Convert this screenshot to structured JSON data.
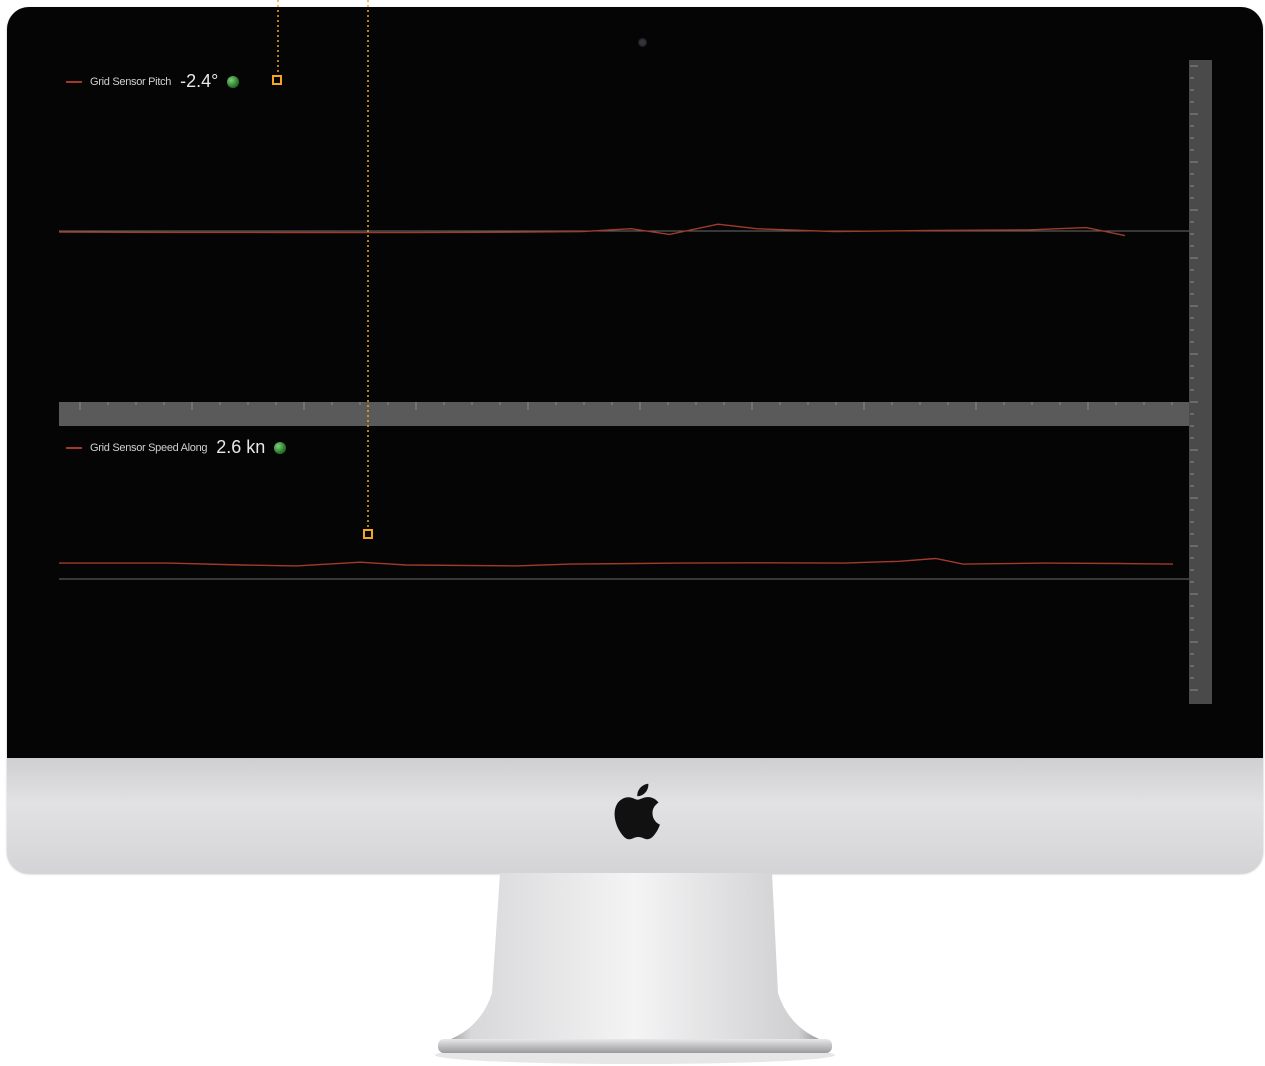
{
  "pitch_panel": {
    "series_name": "Grid Sensor Pitch",
    "current_value": "-2.4°",
    "status_color": "#3e9a3a",
    "series_color": "#a23a2a"
  },
  "speed_panel": {
    "series_name": "Grid Sensor Speed Along",
    "current_value": "2.6 kn",
    "status_color": "#3e9a3a",
    "series_color": "#a23a2a"
  },
  "colors": {
    "background": "#050505",
    "axis_bar": "#5a5a5a",
    "annotation_marker": "#f5a623"
  },
  "icons": {
    "device_logo": "apple-logo-icon",
    "status_indicator": "green-led-icon",
    "annotation": "highlight-marker-icon"
  },
  "chart_data": [
    {
      "type": "line",
      "series": [
        {
          "name": "Grid Sensor Pitch",
          "x": [
            0,
            120,
            240,
            360,
            480,
            540,
            590,
            630,
            680,
            720,
            800,
            900,
            1000,
            1060,
            1100
          ],
          "y": [
            -1,
            -1.2,
            -1.3,
            -1.4,
            -1,
            -0.5,
            2,
            -3,
            6,
            2,
            -0.5,
            0.5,
            1,
            3,
            -4
          ]
        }
      ],
      "ylim": [
        -150,
        150
      ]
    },
    {
      "type": "line",
      "series": [
        {
          "name": "Grid Sensor Speed Along",
          "x": [
            0,
            60,
            120,
            200,
            260,
            330,
            380,
            500,
            560,
            680,
            760,
            860,
            920,
            960,
            990,
            1080,
            1160,
            1220
          ],
          "y": [
            2.6,
            2.6,
            2.6,
            2.5,
            2.45,
            2.65,
            2.5,
            2.45,
            2.55,
            2.6,
            2.62,
            2.6,
            2.7,
            2.85,
            2.55,
            2.6,
            2.58,
            2.55
          ]
        }
      ],
      "ylim": [
        -5,
        10
      ]
    }
  ]
}
